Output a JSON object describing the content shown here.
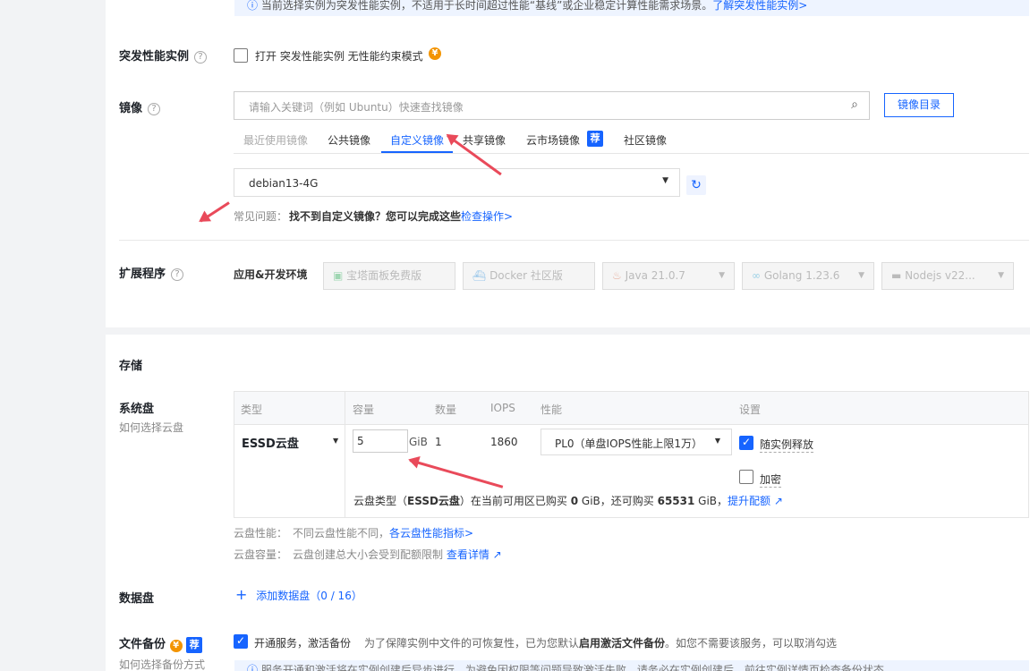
{
  "notice": {
    "text": "当前选择实例为突发性能实例，不适用于长时间超过性能“基线”或企业稳定计算性能需求场景。",
    "link": "了解突发性能实例>"
  },
  "burst": {
    "label": "突发性能实例",
    "checkbox_text": "打开 突发性能实例 无性能约束模式",
    "coin": "¥"
  },
  "image": {
    "label": "镜像",
    "search_placeholder": "请输入关键词（例如 Ubuntu）快速查找镜像",
    "catalog_button": "镜像目录",
    "tabs": [
      "最近使用镜像",
      "公共镜像",
      "自定义镜像",
      "共享镜像",
      "云市场镜像",
      "社区镜像"
    ],
    "tab_badge": "荐",
    "selected": "debian13-4G",
    "faq_prefix": "常见问题：",
    "faq_bold": "找不到自定义镜像？您可以完成这些",
    "faq_link": "检查操作>"
  },
  "extension": {
    "label": "扩展程序",
    "env_label": "应用&开发环境",
    "buttons": [
      {
        "text": "宝塔面板免费版"
      },
      {
        "text": "Docker 社区版"
      },
      {
        "text": "Java 21.0.7"
      },
      {
        "text": "Golang 1.23.6"
      },
      {
        "text": "Nodejs v22..."
      }
    ]
  },
  "storage": {
    "title": "存储",
    "system_disk_label": "系统盘",
    "system_disk_sub": "如何选择云盘",
    "headers": [
      "类型",
      "容量",
      "数量",
      "IOPS",
      "性能",
      "设置"
    ],
    "row": {
      "type": "ESSD云盘",
      "capacity": "5",
      "unit": "GiB",
      "count": "1",
      "iops": "1860",
      "performance": "PL0（单盘IOPS性能上限1万）",
      "release_with_instance": "随实例释放",
      "encrypt": "加密"
    },
    "quota": {
      "p1": "云盘类型（",
      "b1": "ESSD云盘",
      "p2": "）在当前可用区已购买 ",
      "b2": "0",
      "p3": " GiB，还可购买 ",
      "b3": "65531",
      "p4": " GiB，",
      "link": "提升配额"
    },
    "perf_note": {
      "prefix": "云盘性能：",
      "text": "不同云盘性能不同，",
      "link": "各云盘性能指标>"
    },
    "cap_note": {
      "prefix": "云盘容量：",
      "text": "云盘创建总大小会受到配额限制 ",
      "link": "查看详情"
    },
    "data_disk_label": "数据盘",
    "add_data_disk": "添加数据盘",
    "data_disk_count": "（0 / 16）"
  },
  "backup": {
    "label": "文件备份",
    "sub": "如何选择备份方式",
    "coin": "¥",
    "badge": "荐",
    "checkbox_text": "开通服务，激活备份",
    "desc_prefix": "为了保障实例中文件的可恢复性，已为您默认",
    "desc_bold": "启用激活文件备份",
    "desc_suffix": "。如您不需要该服务，可以取消勾选",
    "info": "服务开通和激活将在实例创建后异步进行，为避免因权限等问题导致激活失败，请务必在实例创建后，前往实例详情页检查备份状态"
  },
  "colors": {
    "accent": "#1664ff",
    "arrow": "#e94a5a",
    "coin": "#f39400"
  }
}
